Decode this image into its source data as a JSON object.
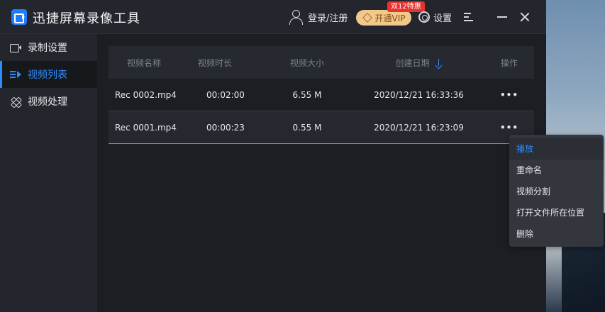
{
  "app": {
    "title": "迅捷屏幕录像工具",
    "login_label": "登录/注册",
    "vip_label": "开通VIP",
    "vip_badge": "双12特惠",
    "settings_label": "设置"
  },
  "sidebar": {
    "items": [
      {
        "label": "录制设置",
        "icon": "camera-icon",
        "active": false
      },
      {
        "label": "视频列表",
        "icon": "list-icon",
        "active": true
      },
      {
        "label": "视频处理",
        "icon": "tools-icon",
        "active": false
      }
    ]
  },
  "table": {
    "headers": {
      "name": "视频名称",
      "duration": "视频时长",
      "size": "视频大小",
      "date": "创建日期",
      "ops": "操作"
    },
    "rows": [
      {
        "name": "Rec 0002.mp4",
        "duration": "00:02:00",
        "size": "6.55 M",
        "date": "2020/12/21 16:33:36",
        "ops": "•••"
      },
      {
        "name": "Rec 0001.mp4",
        "duration": "00:00:23",
        "size": "0.55 M",
        "date": "2020/12/21 16:23:09",
        "ops": "•••"
      }
    ]
  },
  "context_menu": {
    "items": [
      {
        "label": "播放",
        "active": true
      },
      {
        "label": "重命名",
        "active": false
      },
      {
        "label": "视频分割",
        "active": false
      },
      {
        "label": "打开文件所在位置",
        "active": false
      },
      {
        "label": "删除",
        "active": false
      }
    ]
  },
  "colors": {
    "accent": "#2e8bff",
    "vip_gold": "#f2c98b",
    "badge_red": "#e8322d"
  }
}
